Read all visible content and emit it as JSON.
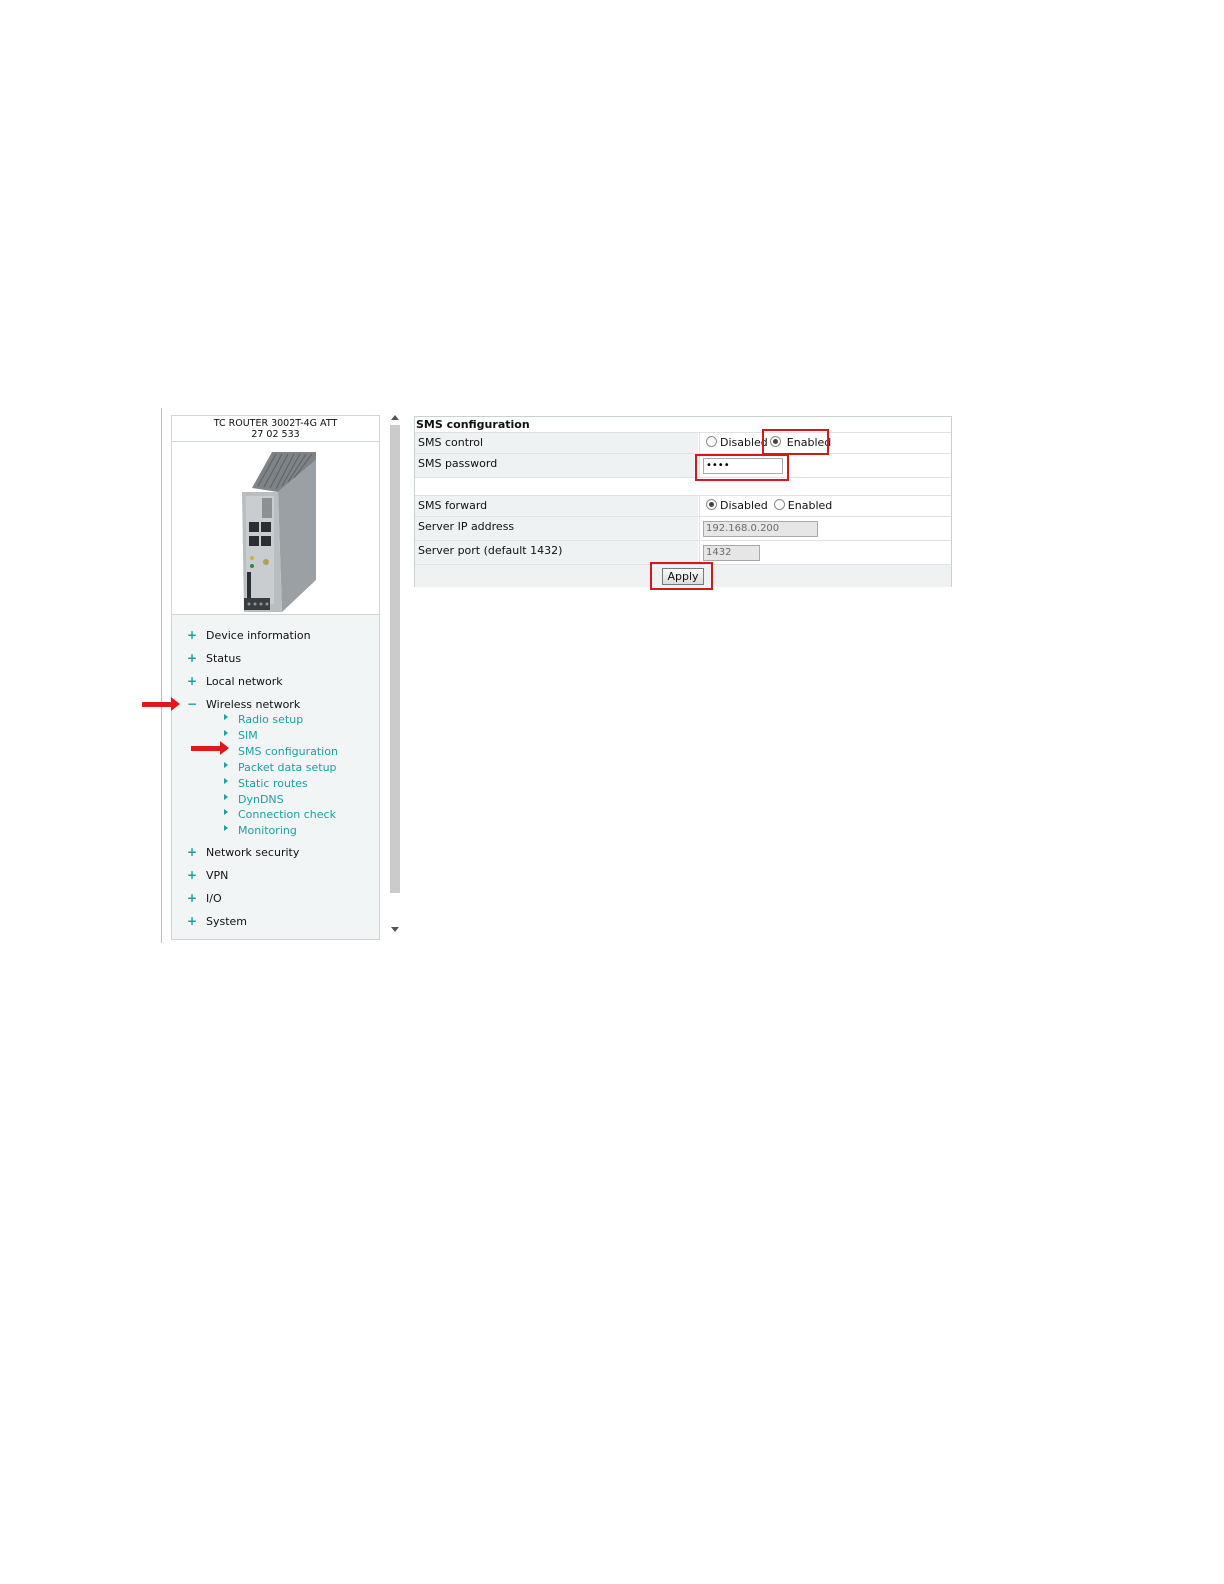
{
  "device": {
    "name": "TC ROUTER 3002T-4G ATT",
    "part_number": "27 02 533"
  },
  "nav": {
    "items": [
      {
        "sign": "+",
        "label": "Device information"
      },
      {
        "sign": "+",
        "label": "Status"
      },
      {
        "sign": "+",
        "label": "Local network"
      },
      {
        "sign": "−",
        "label": "Wireless network"
      },
      {
        "sign": "+",
        "label": "Network security"
      },
      {
        "sign": "+",
        "label": "VPN"
      },
      {
        "sign": "+",
        "label": "I/O"
      },
      {
        "sign": "+",
        "label": "System"
      }
    ],
    "wireless_sub": [
      "Radio setup",
      "SIM",
      "SMS configuration",
      "Packet data setup",
      "Static routes",
      "DynDNS",
      "Connection check",
      "Monitoring"
    ]
  },
  "config": {
    "title": "SMS configuration",
    "sms_control": {
      "label": "SMS control",
      "options": [
        "Disabled",
        "Enabled"
      ],
      "selected": "Enabled"
    },
    "sms_password": {
      "label": "SMS password",
      "value": "••••"
    },
    "sms_forward": {
      "label": "SMS forward",
      "options": [
        "Disabled",
        "Enabled"
      ],
      "selected": "Disabled"
    },
    "server_ip": {
      "label": "Server IP address",
      "value": "192.168.0.200"
    },
    "server_port": {
      "label": "Server port (default 1432)",
      "value": "1432"
    },
    "apply_label": "Apply"
  },
  "colors": {
    "accent": "#1e9ea0",
    "highlight": "#d2191e",
    "row_bg": "#eef2f3"
  }
}
